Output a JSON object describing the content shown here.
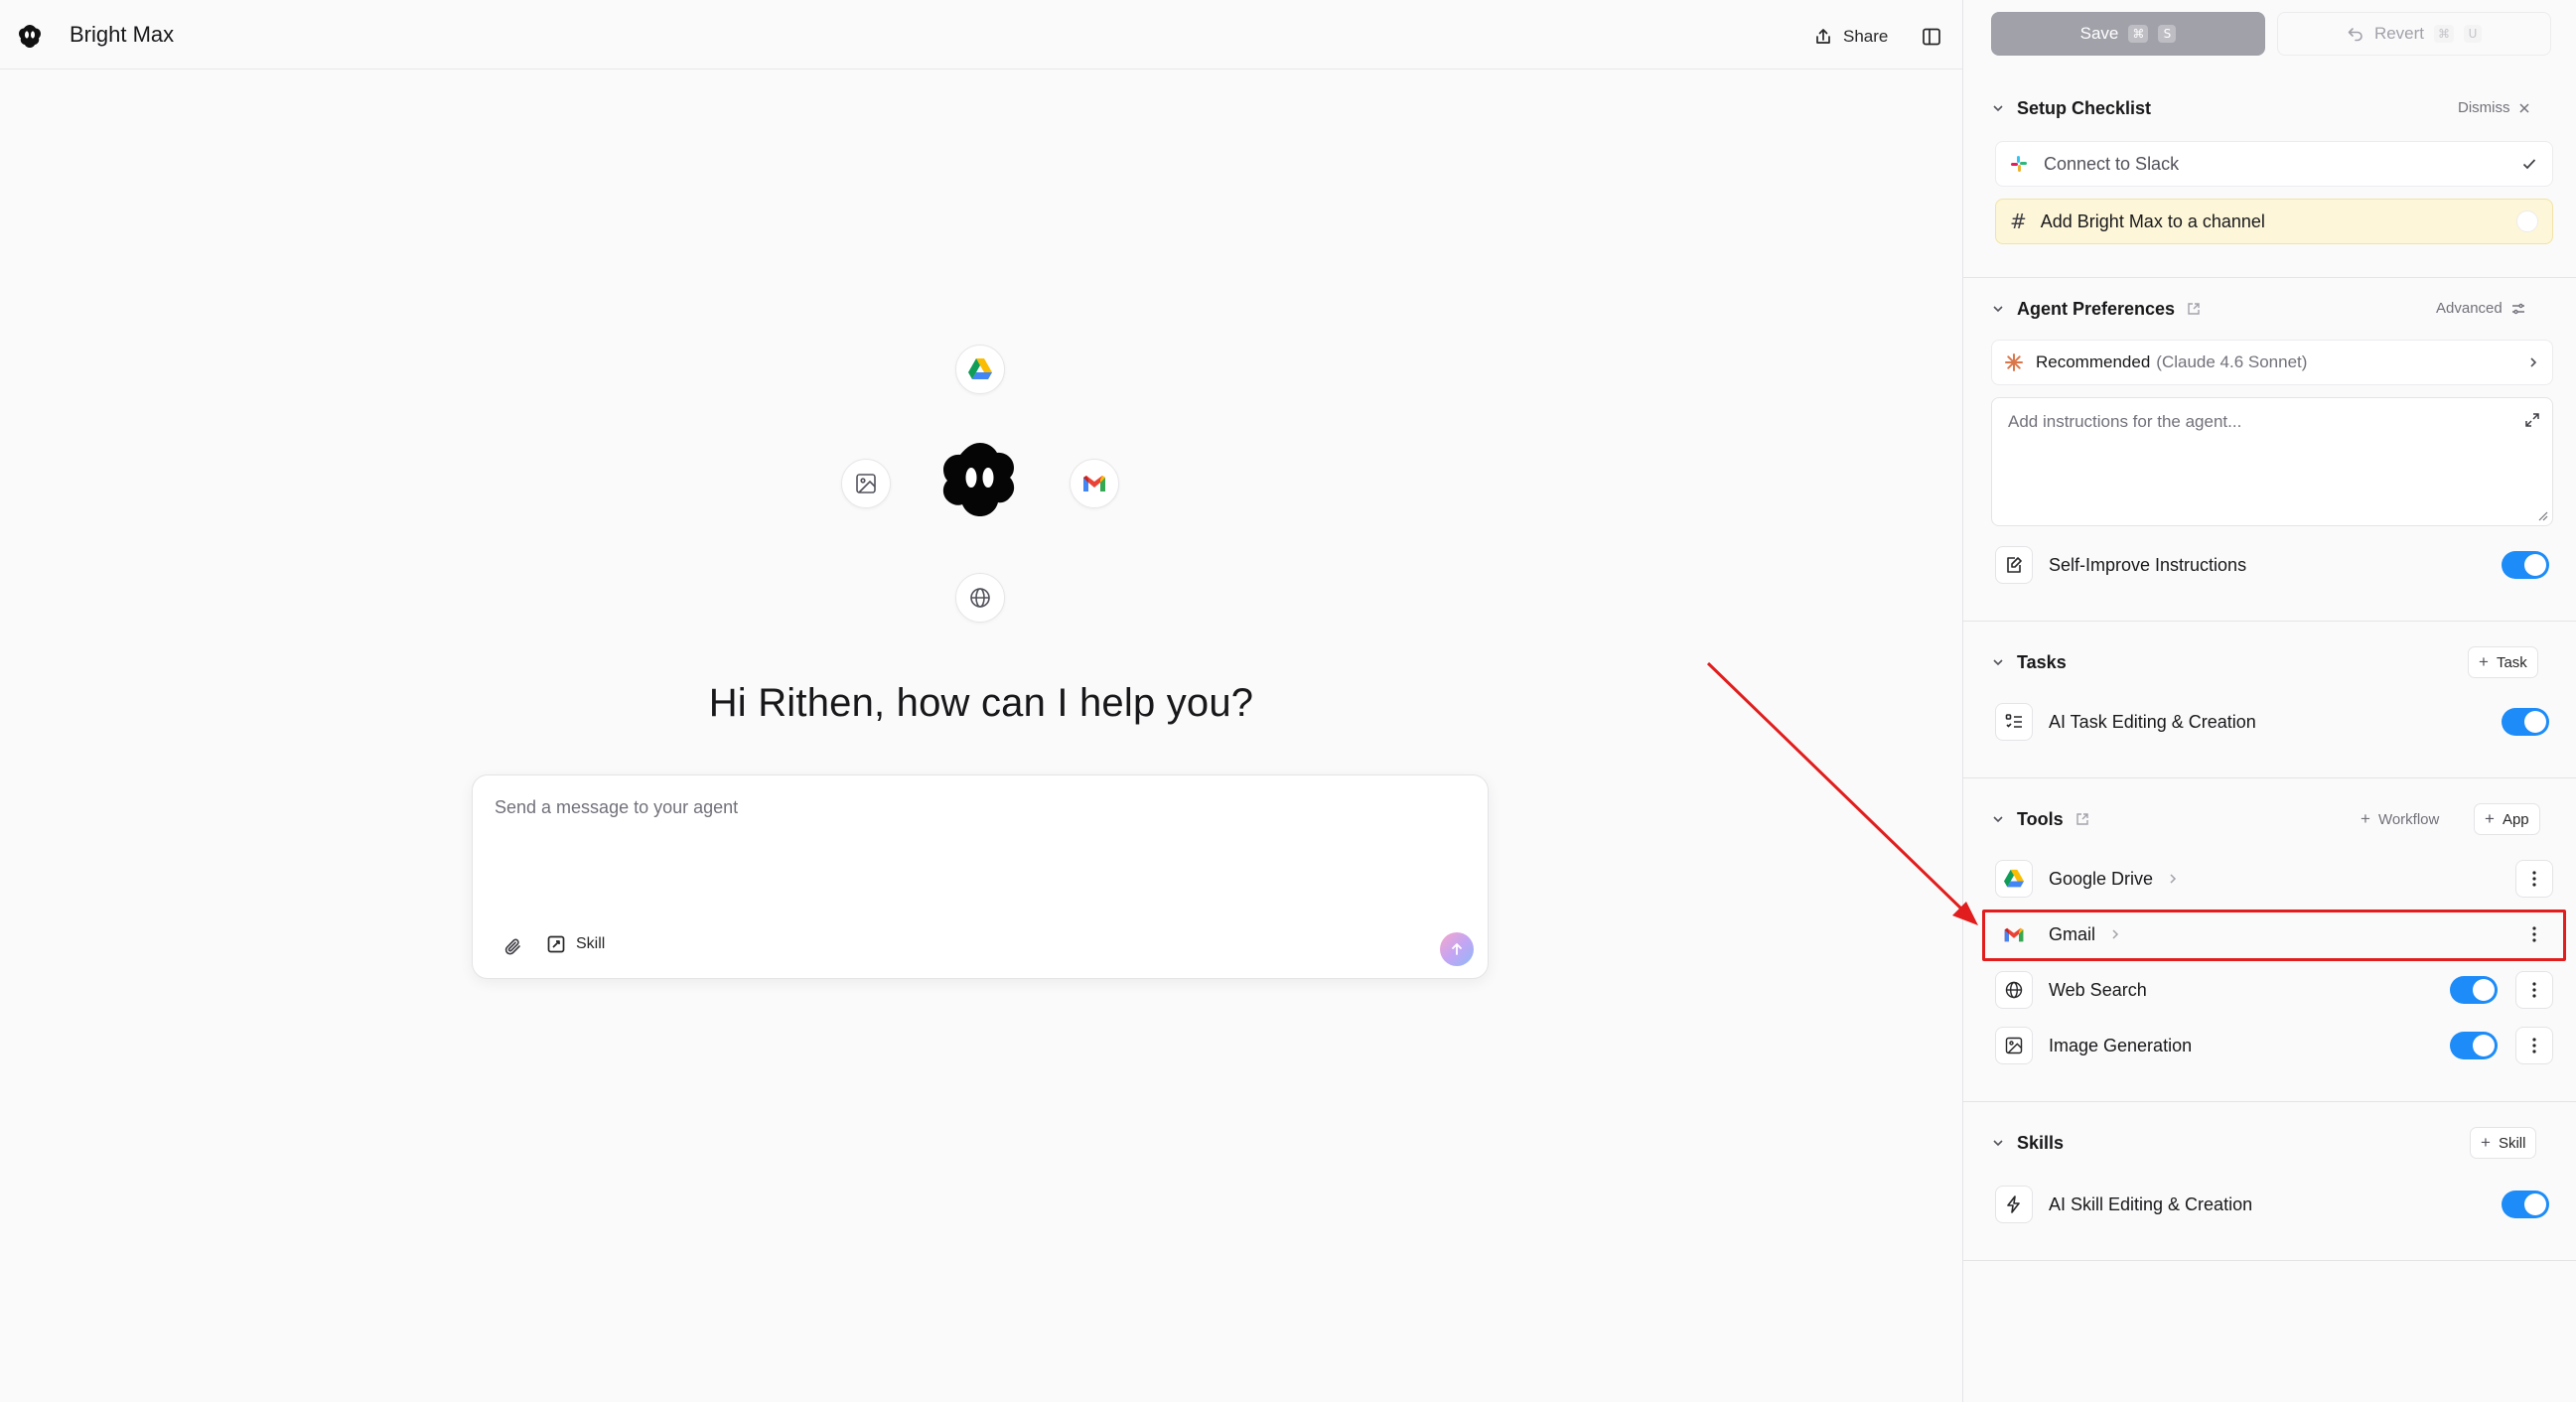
{
  "app": {
    "name": "Bright Max",
    "share_label": "Share"
  },
  "hub": {
    "icons": [
      "google-drive-icon",
      "gmail-icon",
      "image-icon",
      "globe-icon"
    ]
  },
  "main": {
    "greeting": "Hi Rithen, how can I help you?",
    "composer": {
      "placeholder": "Send a message to your agent",
      "skill_label": "Skill"
    }
  },
  "toolbar": {
    "save_label": "Save",
    "save_keys": [
      "⌘",
      "S"
    ],
    "revert_label": "Revert",
    "revert_keys": [
      "⌘",
      "U"
    ]
  },
  "checklist": {
    "title": "Setup Checklist",
    "dismiss_label": "Dismiss",
    "items": [
      {
        "label": "Connect to Slack",
        "done": true
      },
      {
        "label": "Add Bright Max to a channel",
        "done": false
      }
    ]
  },
  "preferences": {
    "title": "Agent Preferences",
    "advanced_label": "Advanced",
    "model_label": "Recommended",
    "model_detail": "(Claude 4.6 Sonnet)",
    "instructions_placeholder": "Add instructions for the agent...",
    "self_improve_label": "Self-Improve Instructions",
    "self_improve_on": true
  },
  "tasks": {
    "title": "Tasks",
    "add_label": "Task",
    "items": [
      {
        "label": "AI Task Editing & Creation",
        "on": true
      }
    ]
  },
  "tools": {
    "title": "Tools",
    "workflow_label": "Workflow",
    "app_label": "App",
    "items": [
      {
        "label": "Google Drive",
        "icon": "google-drive-icon"
      },
      {
        "label": "Gmail",
        "icon": "gmail-icon",
        "highlighted": true
      },
      {
        "label": "Web Search",
        "icon": "globe-icon",
        "on": true
      },
      {
        "label": "Image Generation",
        "icon": "image-icon",
        "on": true
      }
    ]
  },
  "skills": {
    "title": "Skills",
    "add_label": "Skill",
    "items": [
      {
        "label": "AI Skill Editing & Creation",
        "on": true
      }
    ]
  },
  "colors": {
    "accent_toggle": "#1d8cf8",
    "annotation_red": "#e11d1d",
    "checklist_highlight": "#fdf6d8"
  }
}
